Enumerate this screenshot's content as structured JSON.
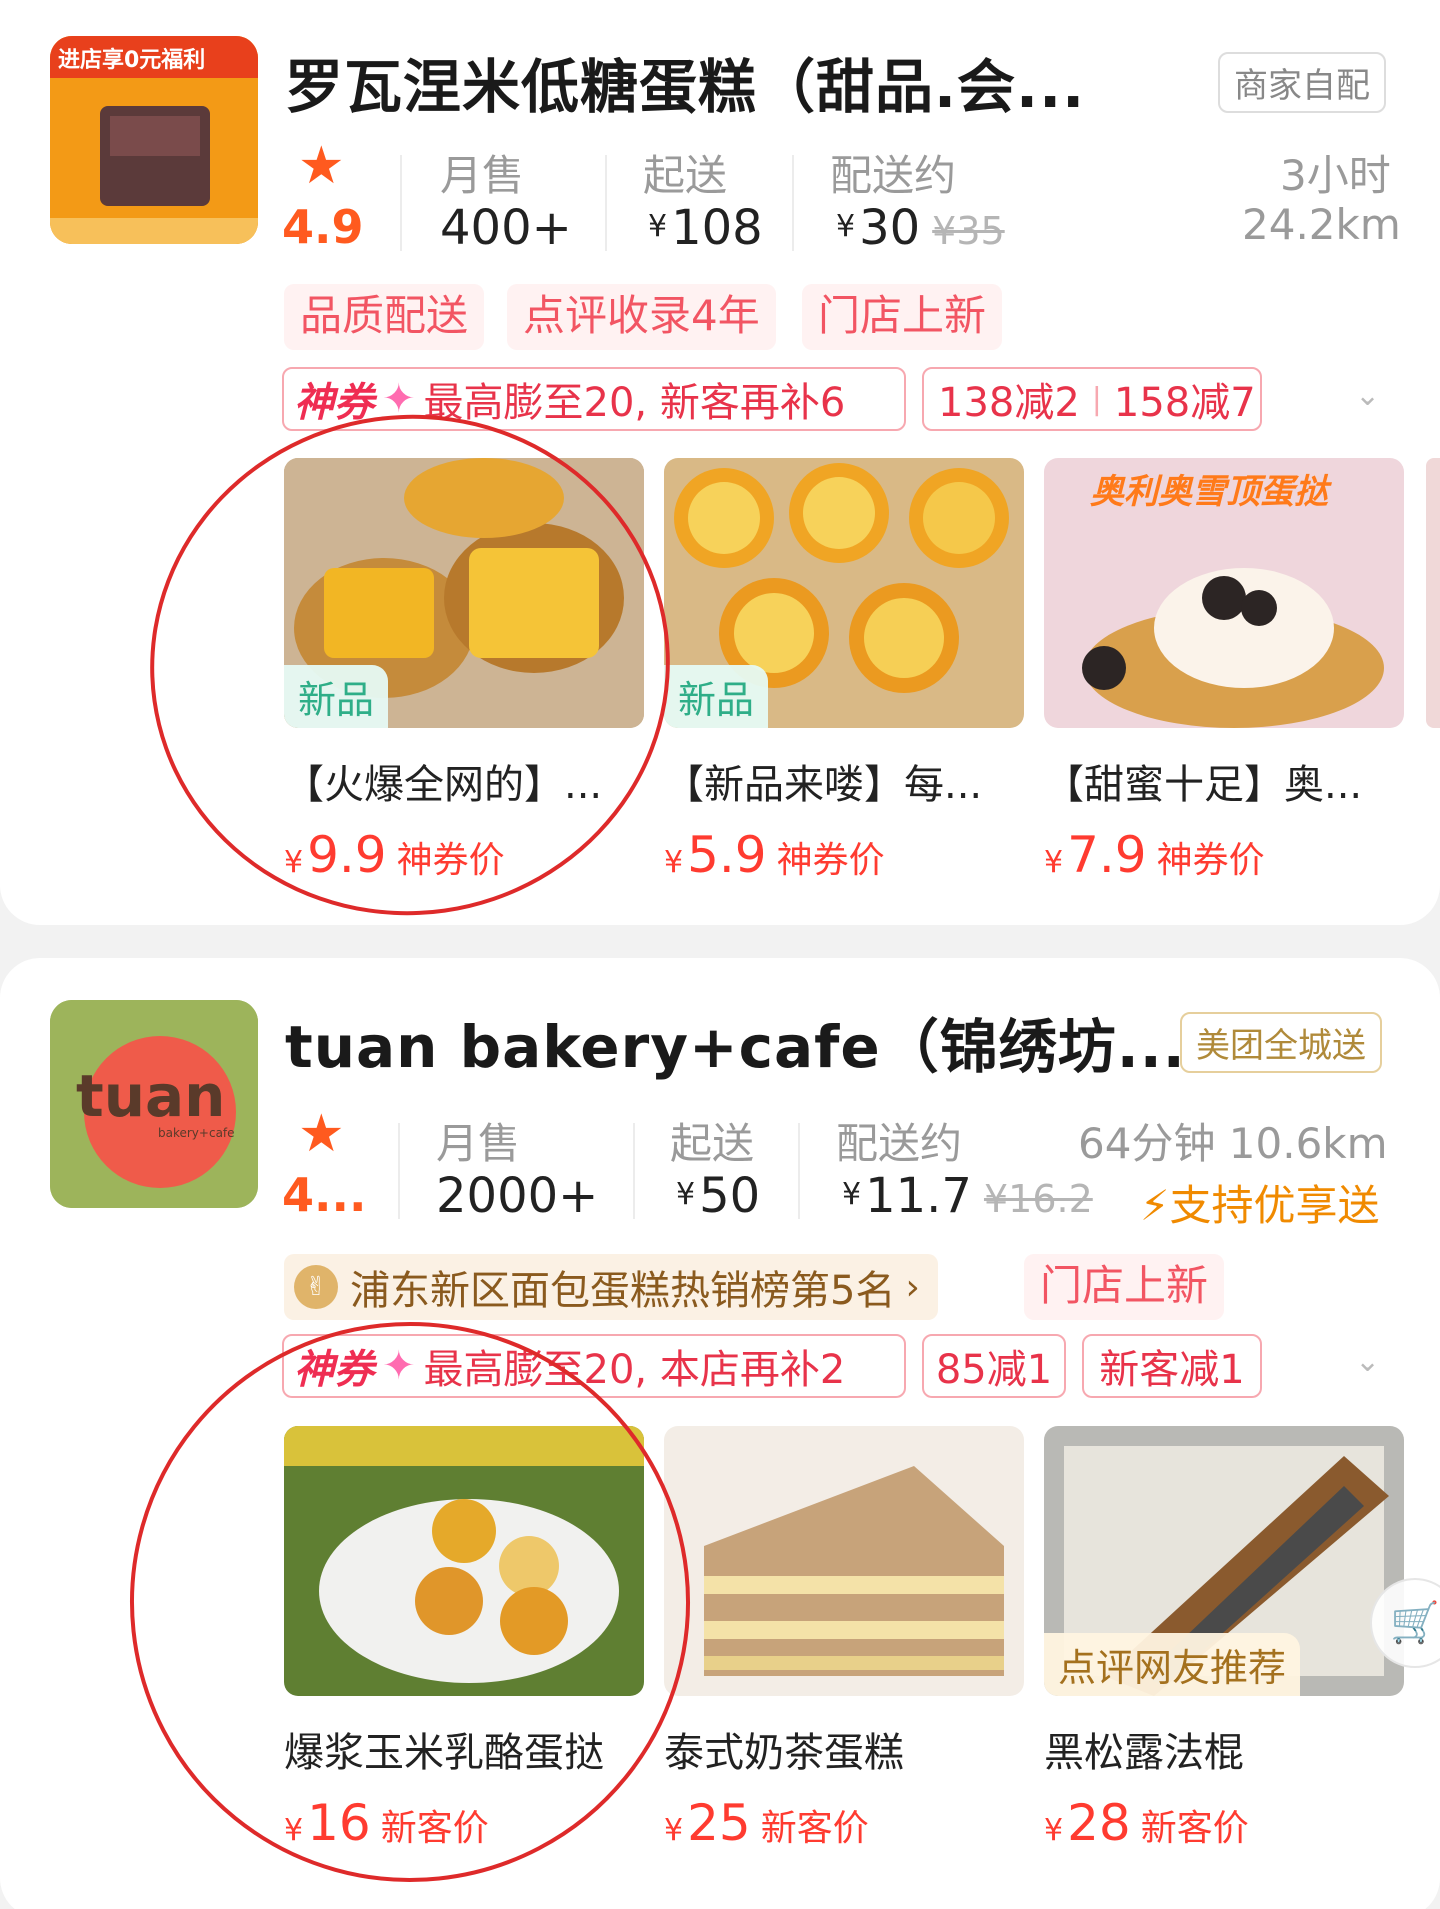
{
  "stores": [
    {
      "logo_text": "进店享0元福利",
      "name": "罗瓦涅米低糖蛋糕（甜品.会...",
      "delivery_badge": "商家自配",
      "rating": "4.9",
      "monthly_sales_label": "月售",
      "monthly_sales": "400+",
      "min_order_label": "起送",
      "min_order": "108",
      "delivery_fee_label": "配送约",
      "delivery_fee": "30",
      "delivery_fee_original": "¥35",
      "delivery_time": "3小时",
      "distance": "24.2km",
      "tags": [
        "品质配送",
        "点评收录4年",
        "门店上新"
      ],
      "coupon_brand": "神券",
      "coupon_text": "最高膨至20, 新客再补6",
      "discounts": [
        "138减2",
        "158减7"
      ],
      "products": [
        {
          "tag": "新品",
          "title": "【火爆全网的】...",
          "currency": "¥",
          "price": "9.9",
          "price_label": "神券价"
        },
        {
          "tag": "新品",
          "title": "【新品来喽】每...",
          "currency": "¥",
          "price": "5.9",
          "price_label": "神券价"
        },
        {
          "tag": "",
          "image_text": "奥利奥雪顶蛋挞",
          "title": "【甜蜜十足】奥...",
          "currency": "¥",
          "price": "7.9",
          "price_label": "神券价"
        }
      ]
    },
    {
      "logo_text": "tuan",
      "logo_subtext": "bakery+cafe",
      "name": "tuan bakery+cafe（锦绣坊...",
      "delivery_badge": "美团全城送",
      "rating": "4...",
      "monthly_sales_label": "月售",
      "monthly_sales": "2000+",
      "min_order_label": "起送",
      "min_order": "50",
      "delivery_fee_label": "配送约",
      "delivery_fee": "11.7",
      "delivery_fee_original": "¥16.2",
      "delivery_time_distance": "64分钟 10.6km",
      "express_label": "支持优享送",
      "rank_text": "浦东新区面包蛋糕热销榜第5名",
      "tags": [
        "门店上新"
      ],
      "coupon_brand": "神券",
      "coupon_text": "最高膨至20, 本店再补2",
      "discounts": [
        "85减1",
        "新客减1"
      ],
      "products": [
        {
          "tag": "",
          "title": "爆浆玉米乳酪蛋挞",
          "currency": "¥",
          "price": "16",
          "price_label": "新客价"
        },
        {
          "tag": "",
          "title": "泰式奶茶蛋糕",
          "currency": "¥",
          "price": "25",
          "price_label": "新客价"
        },
        {
          "tag": "点评网友推荐",
          "title": "黑松露法棍",
          "currency": "¥",
          "price": "28",
          "price_label": "新客价"
        }
      ]
    }
  ],
  "colors": {
    "accent": "#ff5a1f",
    "price": "#ff3b30",
    "tag_bg": "#fff2f2",
    "tag_text": "#f25563",
    "annotation": "#de2a2a"
  }
}
